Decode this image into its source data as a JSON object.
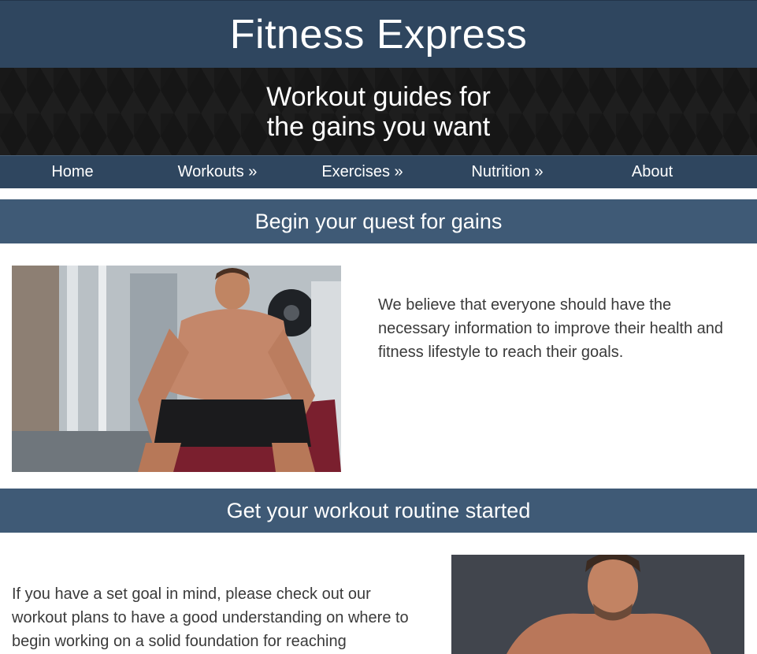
{
  "header": {
    "title": "Fitness Express"
  },
  "hero": {
    "tagline_line1": "Workout guides for",
    "tagline_line2": "the gains you want"
  },
  "nav": {
    "items": [
      {
        "label": "Home"
      },
      {
        "label": "Workouts »"
      },
      {
        "label": "Exercises »"
      },
      {
        "label": "Nutrition »"
      },
      {
        "label": "About"
      }
    ]
  },
  "sections": [
    {
      "heading": "Begin your quest for gains",
      "text": "We believe that everyone should have the necessary information to improve their health and fitness lifestyle to reach their goals."
    },
    {
      "heading": "Get your workout routine started",
      "text": "If you have a set goal in mind, please check out our workout plans to have a good understanding on where to begin working on a solid foundation for reaching"
    }
  ],
  "colors": {
    "header_bg": "#2f465f",
    "band_bg": "#3f5a76",
    "hero_bg": "#161616",
    "text": "#3a3a3a"
  }
}
